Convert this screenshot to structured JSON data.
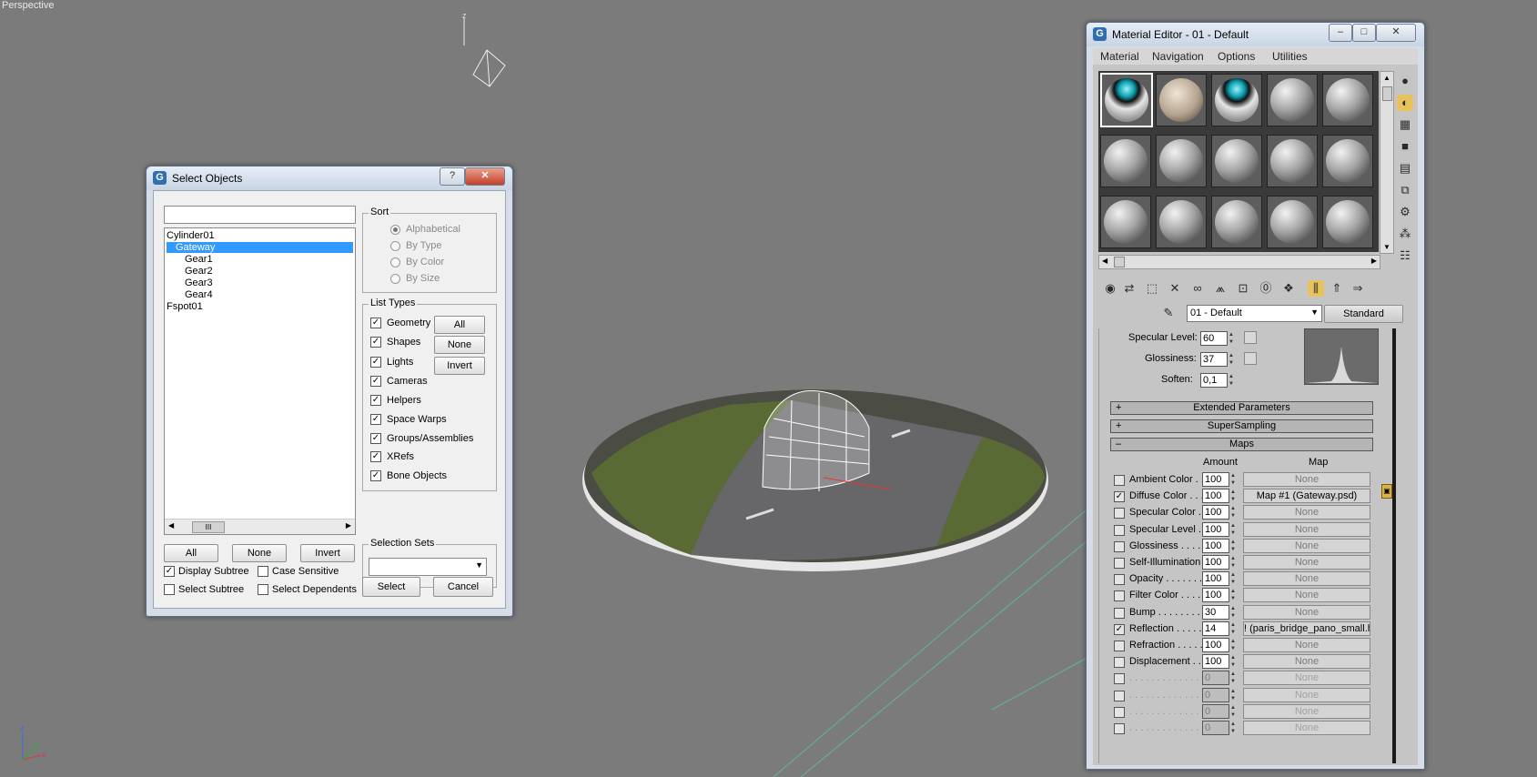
{
  "viewport": {
    "label": "Perspective"
  },
  "select_objects": {
    "title": "Select Objects",
    "help_btn": "?",
    "close_btn": "✕",
    "search_value": "",
    "objects": [
      "Cylinder01",
      "Gateway",
      "Gear1",
      "Gear2",
      "Gear3",
      "Gear4",
      "Fspot01"
    ],
    "selected_object": "Gateway",
    "scroll_thumb": "III",
    "sort": {
      "title": "Sort",
      "options": [
        "Alphabetical",
        "By Type",
        "By Color",
        "By Size"
      ],
      "selected": "Alphabetical"
    },
    "list_types": {
      "title": "List Types",
      "items": [
        "Geometry",
        "Shapes",
        "Lights",
        "Cameras",
        "Helpers",
        "Space Warps",
        "Groups/Assemblies",
        "XRefs",
        "Bone Objects"
      ],
      "buttons": [
        "All",
        "None",
        "Invert"
      ]
    },
    "bottom_buttons": [
      "All",
      "None",
      "Invert"
    ],
    "options": {
      "display_subtree": "Display Subtree",
      "case_sensitive": "Case Sensitive",
      "select_subtree": "Select Subtree",
      "select_dependents": "Select Dependents"
    },
    "selection_sets": {
      "title": "Selection Sets",
      "value": ""
    },
    "select_btn": "Select",
    "cancel_btn": "Cancel"
  },
  "material_editor": {
    "title": "Material Editor - 01 - Default",
    "menu": [
      "Material",
      "Navigation",
      "Options",
      "Utilities"
    ],
    "material_name": "01 - Default",
    "material_type": "Standard",
    "specular": {
      "specular_level_label": "Specular Level:",
      "specular_level": "60",
      "glossiness_label": "Glossiness:",
      "glossiness": "37",
      "soften_label": "Soften:",
      "soften": "0,1"
    },
    "rollouts": {
      "extended": "Extended Parameters",
      "supersampling": "SuperSampling",
      "maps": "Maps"
    },
    "maps_header": {
      "amount": "Amount",
      "map": "Map"
    },
    "maps": [
      {
        "name": "Ambient Color . . .",
        "amount": "100",
        "map": "None",
        "checked": false
      },
      {
        "name": "Diffuse Color . . .",
        "amount": "100",
        "map": "Map #1 (Gateway.psd)",
        "checked": true
      },
      {
        "name": "Specular Color . .",
        "amount": "100",
        "map": "None",
        "checked": false
      },
      {
        "name": "Specular Level .",
        "amount": "100",
        "map": "None",
        "checked": false
      },
      {
        "name": "Glossiness . . . . .",
        "amount": "100",
        "map": "None",
        "checked": false
      },
      {
        "name": "Self-Illumination .",
        "amount": "100",
        "map": "None",
        "checked": false
      },
      {
        "name": "Opacity . . . . . . . .",
        "amount": "100",
        "map": "None",
        "checked": false
      },
      {
        "name": "Filter Color . . . .",
        "amount": "100",
        "map": "None",
        "checked": false
      },
      {
        "name": "Bump . . . . . . . . .",
        "amount": "30",
        "map": "None",
        "checked": false
      },
      {
        "name": "Reflection . . . . .",
        "amount": "14",
        "map": "! (paris_bridge_pano_small.hdr)",
        "checked": true
      },
      {
        "name": "Refraction . . . . .",
        "amount": "100",
        "map": "None",
        "checked": false
      },
      {
        "name": "Displacement . .",
        "amount": "100",
        "map": "None",
        "checked": false
      },
      {
        "name": ". . . . . . . . . . . . .",
        "amount": "0",
        "map": "None",
        "checked": false,
        "disabled": true
      },
      {
        "name": ". . . . . . . . . . . . .",
        "amount": "0",
        "map": "None",
        "checked": false,
        "disabled": true
      },
      {
        "name": ". . . . . . . . . . . . .",
        "amount": "0",
        "map": "None",
        "checked": false,
        "disabled": true
      },
      {
        "name": ". . . . . . . . . . . . .",
        "amount": "0",
        "map": "None",
        "checked": false,
        "disabled": true
      }
    ]
  }
}
